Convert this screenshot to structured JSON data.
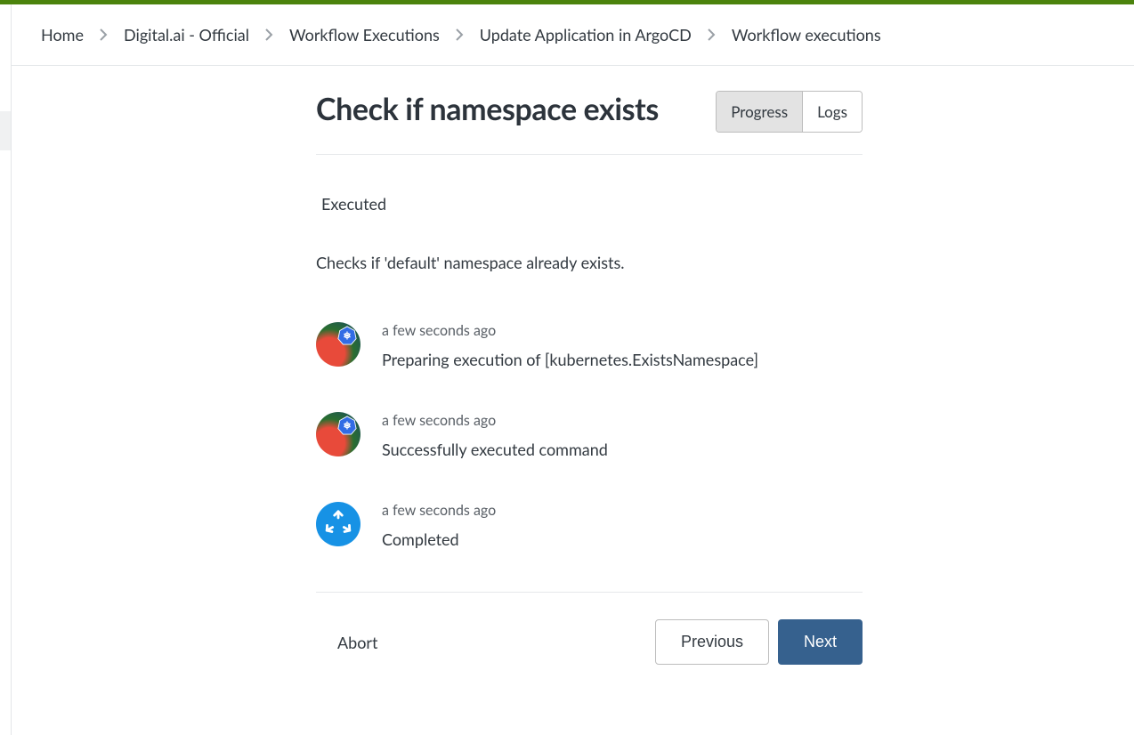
{
  "breadcrumb": {
    "items": [
      {
        "label": "Home"
      },
      {
        "label": "Digital.ai - Official"
      },
      {
        "label": "Workflow Executions"
      },
      {
        "label": "Update Application in ArgoCD"
      },
      {
        "label": "Workflow executions"
      }
    ]
  },
  "page": {
    "title": "Check if namespace exists"
  },
  "tabs": {
    "progress": "Progress",
    "logs": "Logs",
    "active": "progress"
  },
  "status": {
    "label": "Executed",
    "description": "Checks if 'default' namespace already exists."
  },
  "log": {
    "items": [
      {
        "timestamp": "a few seconds ago",
        "message": "Preparing execution of [kubernetes.ExistsNamespace]",
        "icon": "k8s"
      },
      {
        "timestamp": "a few seconds ago",
        "message": "Successfully executed command",
        "icon": "k8s"
      },
      {
        "timestamp": "a few seconds ago",
        "message": "Completed",
        "icon": "completed"
      }
    ]
  },
  "footer": {
    "abort": "Abort",
    "previous": "Previous",
    "next": "Next"
  }
}
